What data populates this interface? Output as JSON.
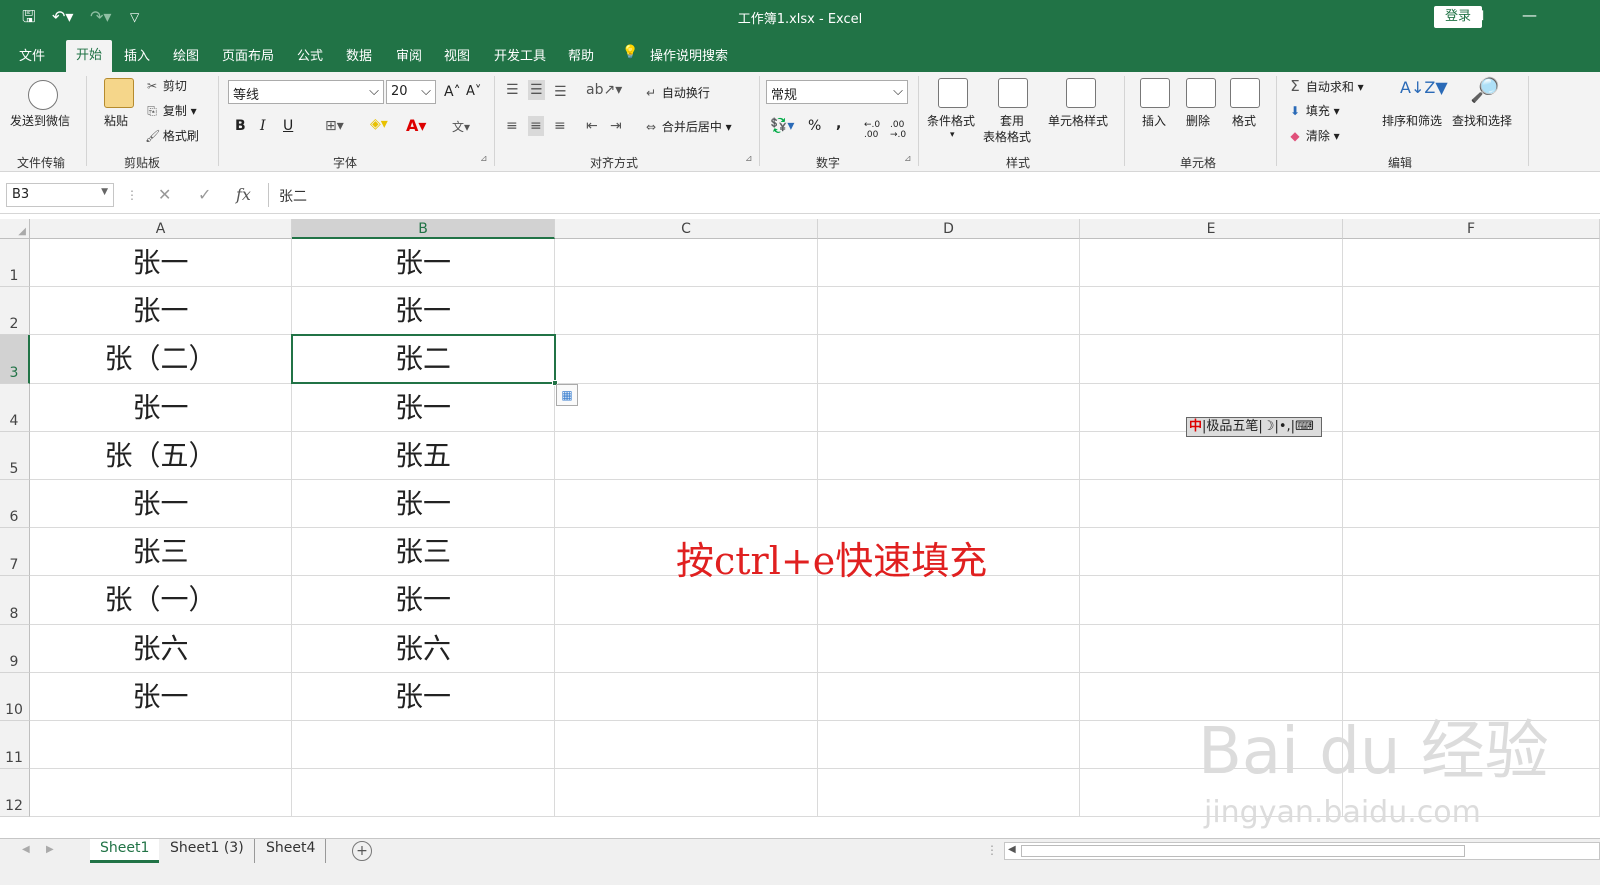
{
  "titlebar": {
    "title": "工作簿1.xlsx  -  Excel",
    "login": "登录",
    "save_icon": "save-icon",
    "undo_icon": "undo-icon",
    "redo_icon": "redo-icon"
  },
  "menu": {
    "tabs": [
      "文件",
      "开始",
      "插入",
      "绘图",
      "页面布局",
      "公式",
      "数据",
      "审阅",
      "视图",
      "开发工具",
      "帮助"
    ],
    "active_tab": "开始",
    "search": "操作说明搜索"
  },
  "ribbon": {
    "file_transfer": {
      "button": "发送到微信",
      "group": "文件传输"
    },
    "clipboard": {
      "paste": "粘贴",
      "cut": "剪切",
      "copy": "复制",
      "format_painter": "格式刷",
      "group": "剪贴板"
    },
    "font": {
      "name": "等线",
      "size": "20",
      "bold": "B",
      "italic": "I",
      "underline": "U",
      "group": "字体"
    },
    "alignment": {
      "wrap": "自动换行",
      "merge": "合并后居中",
      "group": "对齐方式"
    },
    "number": {
      "format": "常规",
      "group": "数字"
    },
    "styles": {
      "conditional": "条件格式",
      "table1": "套用",
      "table2": "表格格式",
      "cell_styles": "单元格样式",
      "group": "样式"
    },
    "cells": {
      "insert": "插入",
      "delete": "删除",
      "format": "格式",
      "group": "单元格"
    },
    "editing": {
      "autosum": "自动求和",
      "fill": "填充",
      "clear": "清除",
      "sort": "排序和筛选",
      "find": "查找和选择",
      "group": "编辑"
    }
  },
  "formula_bar": {
    "namebox": "B3",
    "cancel": "✕",
    "enter": "✓",
    "fx": "fx",
    "value": "张二"
  },
  "sheet": {
    "columns": [
      "A",
      "B",
      "C",
      "D",
      "E",
      "F"
    ],
    "selected_column": "B",
    "selected_row": "3",
    "rows": [
      {
        "n": "1",
        "A": "张一",
        "B": "张一"
      },
      {
        "n": "2",
        "A": "张一",
        "B": "张一"
      },
      {
        "n": "3",
        "A": "张（二）",
        "B": "张二"
      },
      {
        "n": "4",
        "A": "张一",
        "B": "张一"
      },
      {
        "n": "5",
        "A": "张（五）",
        "B": "张五"
      },
      {
        "n": "6",
        "A": "张一",
        "B": "张一"
      },
      {
        "n": "7",
        "A": "张三",
        "B": "张三"
      },
      {
        "n": "8",
        "A": "张（一）",
        "B": "张一"
      },
      {
        "n": "9",
        "A": "张六",
        "B": "张六"
      },
      {
        "n": "10",
        "A": "张一",
        "B": "张一"
      },
      {
        "n": "11",
        "A": "",
        "B": ""
      },
      {
        "n": "12",
        "A": "",
        "B": ""
      }
    ]
  },
  "annotation": "按ctrl+e快速填充",
  "ime": {
    "mode": "中",
    "name": "极品五笔"
  },
  "sheets": {
    "tabs": [
      "Sheet1",
      "Sheet1 (3)",
      "Sheet4"
    ],
    "active": "Sheet1",
    "add": "+"
  },
  "watermark": {
    "main": "Bai du 经验",
    "url": "jingyan.baidu.com"
  },
  "colors": {
    "accent": "#217346",
    "annotation": "#e02020"
  }
}
